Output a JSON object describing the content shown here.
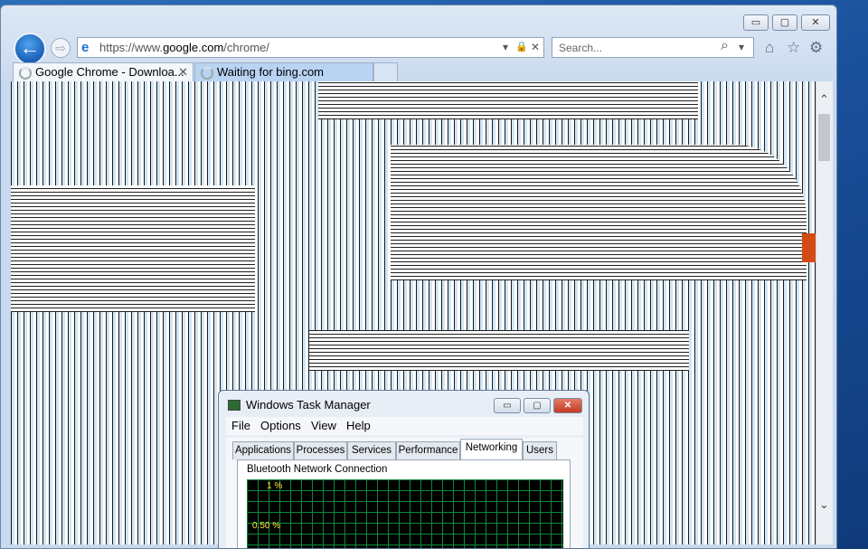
{
  "browser": {
    "address": {
      "protocol": "https://www.",
      "domain": "google.com",
      "path": "/chrome/"
    },
    "search_placeholder": "Search...",
    "tabs": [
      {
        "label": "Google Chrome - Downloa..."
      },
      {
        "label": "Waiting for bing.com"
      }
    ],
    "window_buttons": {
      "minimize": "▭",
      "maximize": "▢",
      "close": "✕"
    },
    "icons": {
      "back": "←",
      "forward": "⇨",
      "ie": "e",
      "dropdown": "▾",
      "lock": "🔒",
      "stop": "✕",
      "search": "⌕",
      "home": "⌂",
      "favorites": "☆",
      "settings": "⚙"
    }
  },
  "task_manager": {
    "title": "Windows Task Manager",
    "menu": [
      "File",
      "Options",
      "View",
      "Help"
    ],
    "tabs": [
      "Applications",
      "Processes",
      "Services",
      "Performance",
      "Networking",
      "Users"
    ],
    "active_tab": "Networking",
    "graph_title": "Bluetooth Network Connection",
    "axis_labels": [
      "1 %",
      "0.50 %"
    ],
    "window_buttons": {
      "minimize": "▭",
      "maximize": "▢",
      "close": "✕"
    }
  },
  "colors": {
    "accent": "#1b5fb8",
    "tab_active": "#b9d3f2",
    "graph_grid": "#0a8a3a",
    "graph_label": "#ffeb3b",
    "close": "#c43a22"
  }
}
